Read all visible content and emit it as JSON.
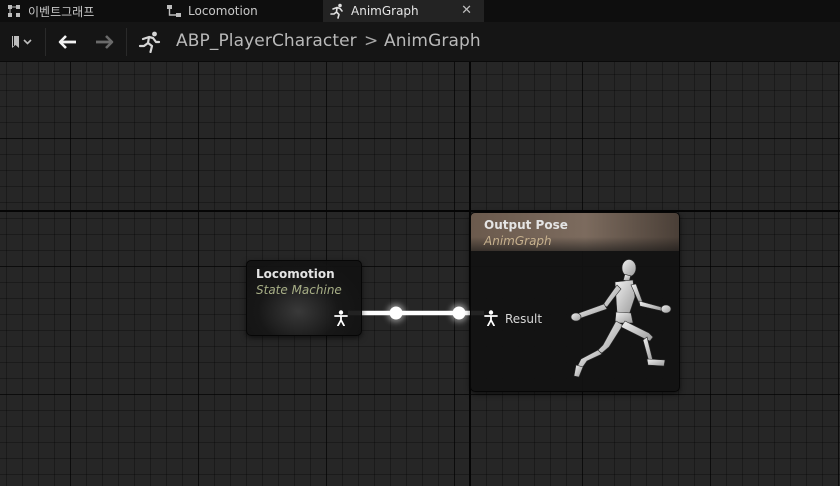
{
  "tabs": [
    {
      "label": "이벤트그래프",
      "icon": "event-graph-icon"
    },
    {
      "label": "Locomotion",
      "icon": "state-machine-icon"
    },
    {
      "label": "AnimGraph",
      "icon": "running-figure-icon",
      "active": true
    }
  ],
  "tab_close": "✕",
  "toolbar": {
    "breadcrumb": {
      "asset": "ABP_PlayerCharacter",
      "separator": ">",
      "graph": "AnimGraph"
    }
  },
  "nodes": {
    "locomotion": {
      "title": "Locomotion",
      "subtitle": "State Machine"
    },
    "output_pose": {
      "title": "Output Pose",
      "subtitle": "AnimGraph",
      "pin_label": "Result"
    }
  },
  "colors": {
    "state_machine_subtitle": "#a7ae86",
    "anim_graph_subtitle": "#c7b18e",
    "output_pose_header": "#7c6b5e",
    "wire": "#ffffff",
    "graph_background": "#262626"
  }
}
